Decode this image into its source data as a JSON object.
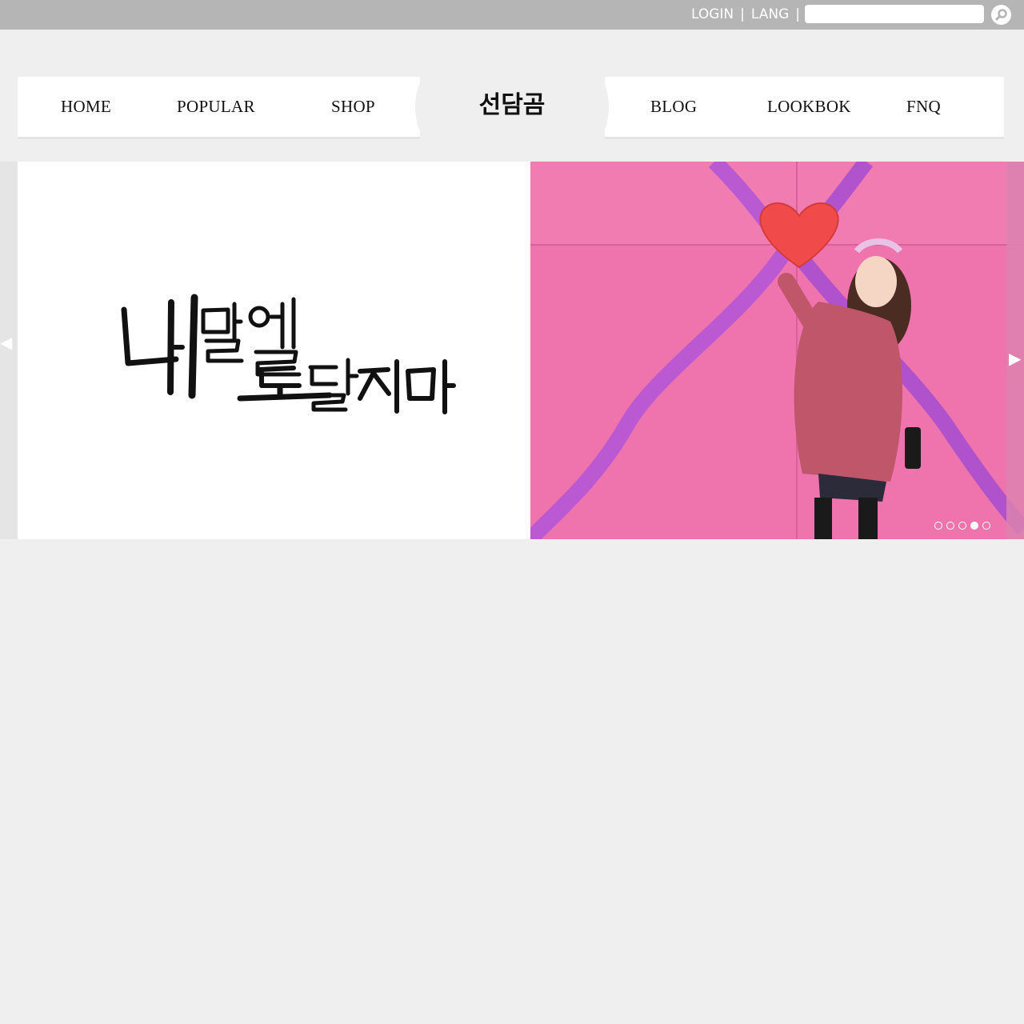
{
  "topbar": {
    "login_label": "LOGIN",
    "separator": "|",
    "lang_label": "LANG",
    "search_placeholder": "",
    "search_icon": "search-icon"
  },
  "nav": {
    "items_left": [
      "HOME",
      "POPULAR",
      "SHOP"
    ],
    "logo": "선담곰",
    "items_right": [
      "BLOG",
      "LOOKBOK",
      "FNQ"
    ]
  },
  "slider": {
    "prev_icon": "triangle-left-icon",
    "next_icon": "triangle-right-icon",
    "dot_count": 5,
    "active_dot": 4,
    "colors": {
      "photo_background": "#ef73ad",
      "ribbon": "#b456d6",
      "heart": "#f04a4a"
    }
  }
}
